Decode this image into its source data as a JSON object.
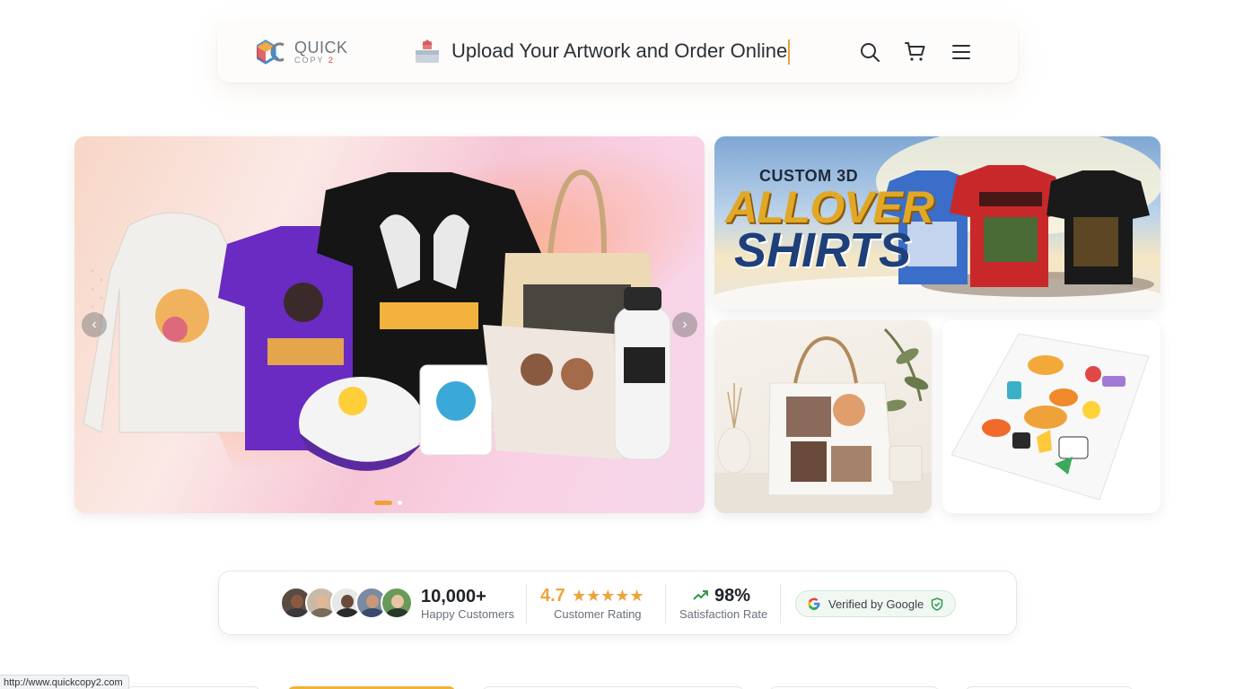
{
  "header": {
    "logo_line1": "QUICK",
    "logo_line2a": "COPY",
    "logo_line2b": "2",
    "upload_label": "Upload Your Artwork and Order Online"
  },
  "hero": {
    "slide_count": 2,
    "active_slide": 1,
    "prev_label": "‹",
    "next_label": "›",
    "shirts_banner": {
      "line1": "CUSTOM 3D",
      "line2": "ALLOVER",
      "line3": "SHIRTS"
    }
  },
  "stats": {
    "customers_value": "10,000+",
    "customers_label": "Happy Customers",
    "rating_value": "4.7",
    "rating_stars": "★★★★★",
    "rating_label": "Customer Rating",
    "satisfaction_value": "98%",
    "satisfaction_label": "Satisfaction Rate",
    "verified_label": "Verified by Google"
  },
  "status_bar": {
    "url": "http://www.quickcopy2.com"
  },
  "colors": {
    "accent": "#f0a23a",
    "verified_bg": "#f1f8f2"
  },
  "icons": [
    "search-icon",
    "cart-icon",
    "menu-icon",
    "upload-icon",
    "trend-up-icon",
    "google-icon",
    "shield-check-icon"
  ]
}
